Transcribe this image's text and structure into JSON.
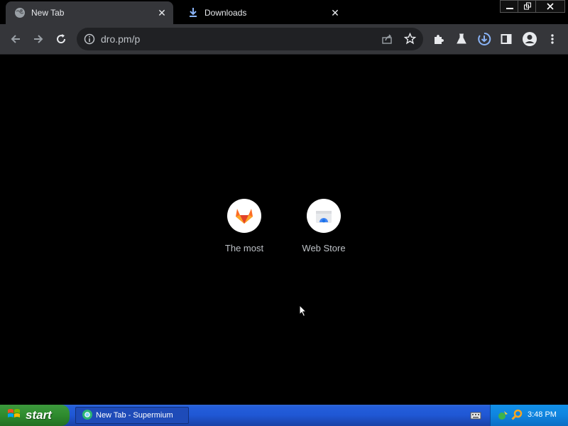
{
  "tabs": [
    {
      "title": "New Tab",
      "icon": "globe-icon",
      "active": true
    },
    {
      "title": "Downloads",
      "icon": "download-icon",
      "active": false
    }
  ],
  "window_controls": [
    "minimize-icon",
    "restore-icon",
    "close-icon"
  ],
  "toolbar": {
    "url": "dro.pm/p",
    "buttons": [
      "back",
      "forward",
      "reload",
      "share",
      "bookmark",
      "extensions",
      "labs",
      "downloads",
      "side-panel",
      "profile",
      "menu"
    ]
  },
  "shortcuts": [
    {
      "label": "The most",
      "icon": "gitlab-fox-icon"
    },
    {
      "label": "Web Store",
      "icon": "webstore-icon"
    }
  ],
  "taskbar": {
    "start_label": "start",
    "task_item": "New Tab - Supermium",
    "clock": "3:48 PM"
  },
  "colors": {
    "tab_active": "#35363a",
    "toolbar": "#35363a",
    "omnibox": "#202124",
    "accent_blue": "#8ab4f8",
    "taskbar_blue": "#245edb",
    "start_green": "#2e8b2e"
  }
}
